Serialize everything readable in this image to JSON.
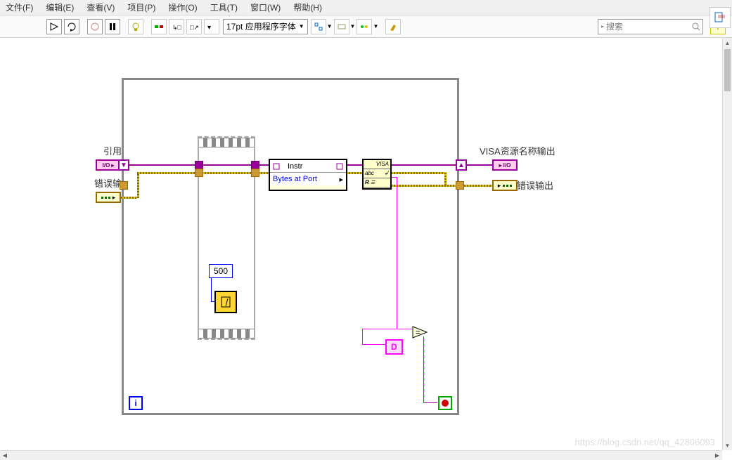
{
  "menu": {
    "file": "文件(F)",
    "edit": "编辑(E)",
    "view": "查看(V)",
    "project": "项目(P)",
    "operate": "操作(O)",
    "tools": "工具(T)",
    "window": "窗口(W)",
    "help": "帮助(H)"
  },
  "toolbar": {
    "font": "17pt 应用程序字体",
    "search_placeholder": "搜索"
  },
  "diagram": {
    "ref_in_label": "引用",
    "error_in_label": "错误输入",
    "visa_out_label": "VISA资源名称输出",
    "error_out_label": "错误输出",
    "io_text": "I/O",
    "instr_label": "Instr",
    "bytes_label": "Bytes at Port",
    "visa_header": "VISA",
    "visa_abc": "abc",
    "visa_r": "R",
    "wait_ms": "500",
    "string_D": "D",
    "compare_op": "=",
    "iter_i": "i"
  },
  "watermark": "https://blog.csdn.net/qq_42806093"
}
